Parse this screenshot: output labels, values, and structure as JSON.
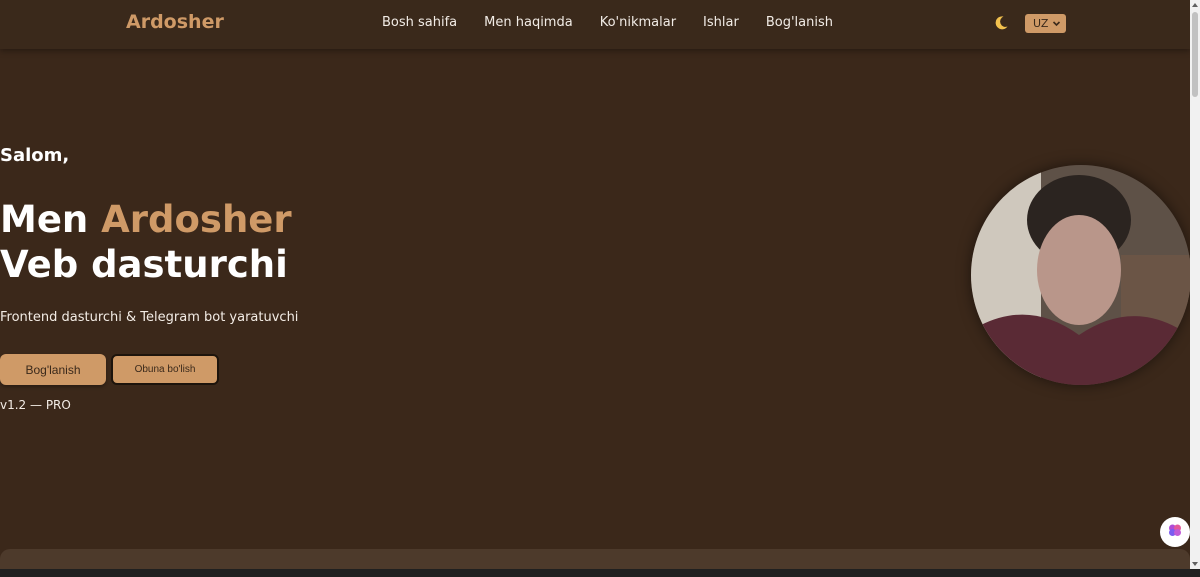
{
  "header": {
    "logo": "Ardosher",
    "nav": [
      "Bosh sahifa",
      "Men haqimda",
      "Ko'nikmalar",
      "Ishlar",
      "Bog'lanish"
    ],
    "theme_icon": "moon-icon",
    "language": "UZ"
  },
  "hero": {
    "greeting": "Salom,",
    "headline_prefix": "Men ",
    "headline_name": "Ardosher",
    "headline_role": "Veb dasturchi",
    "subtitle": "Frontend dasturchi & Telegram bot yaratuvchi",
    "primary_button": "Bog'lanish",
    "secondary_button": "Obuna bo'lish",
    "version": "v1.2 — PRO"
  },
  "colors": {
    "background": "#3b281a",
    "accent": "#cf9a67"
  },
  "widgets": {
    "chat_icon": "brain-icon"
  }
}
